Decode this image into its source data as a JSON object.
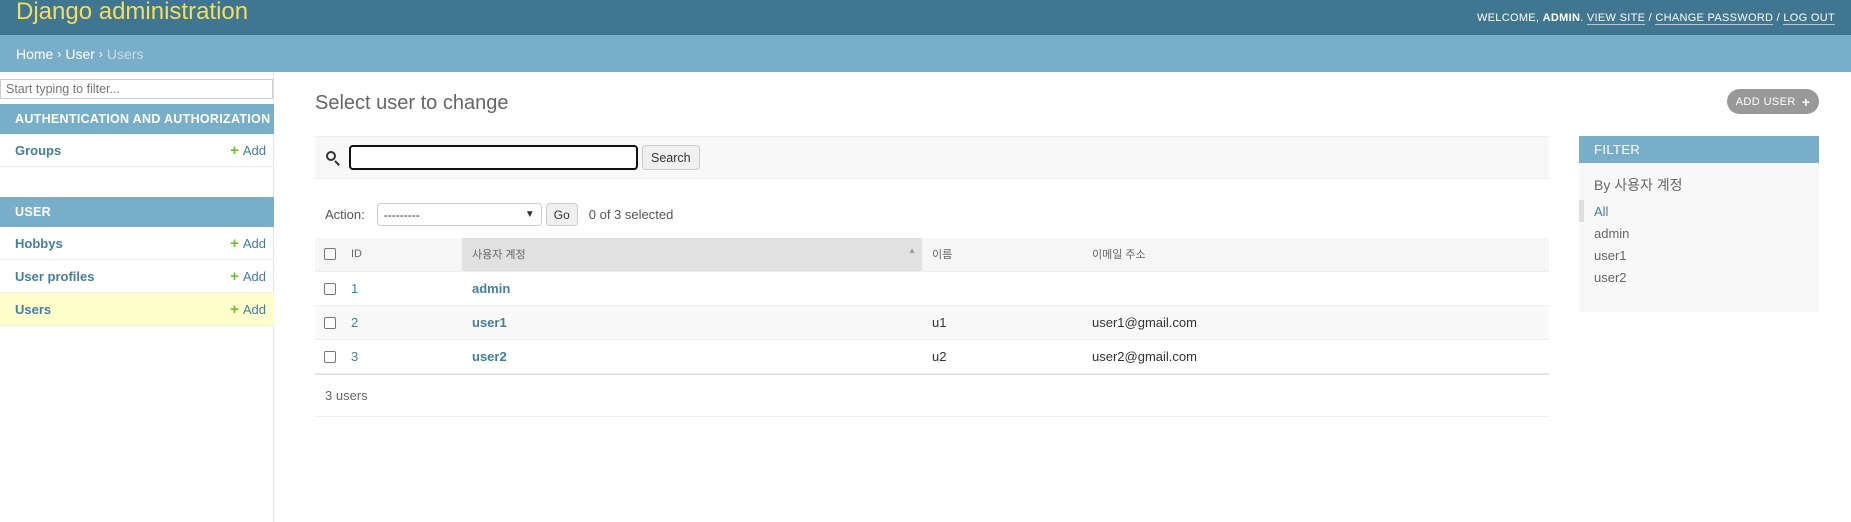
{
  "header": {
    "branding": "Django administration",
    "welcome": "Welcome,",
    "username": "admin",
    "links": [
      "View site",
      "Change password",
      "Log out"
    ]
  },
  "breadcrumbs": [
    "Home",
    "User",
    "Users"
  ],
  "sidebar": {
    "filter_placeholder": "Start typing to filter...",
    "modules": [
      {
        "caption": "Authentication and Authorization",
        "models": [
          {
            "name": "Groups",
            "add": "Add"
          }
        ]
      },
      {
        "caption": "User",
        "models": [
          {
            "name": "Hobbys",
            "add": "Add"
          },
          {
            "name": "User profiles",
            "add": "Add"
          },
          {
            "name": "Users",
            "add": "Add"
          }
        ]
      }
    ]
  },
  "content": {
    "title": "Select user to change",
    "add_button": "Add user",
    "search": {
      "value": "",
      "button": "Search"
    },
    "actions": {
      "label": "Action:",
      "selected": "---------",
      "go": "Go",
      "counter": "0 of 3 selected"
    },
    "table": {
      "headers": [
        "ID",
        "사용자 계정",
        "이름",
        "이메일 주소"
      ],
      "rows": [
        {
          "id": "1",
          "username": "admin",
          "name": "",
          "email": ""
        },
        {
          "id": "2",
          "username": "user1",
          "name": "u1",
          "email": "user1@gmail.com"
        },
        {
          "id": "3",
          "username": "user2",
          "name": "u2",
          "email": "user2@gmail.com"
        }
      ]
    },
    "paginator": "3 users"
  },
  "filter": {
    "caption": "Filter",
    "subtitle": "By 사용자 계정",
    "choices": [
      "All",
      "admin",
      "user1",
      "user2"
    ]
  },
  "colors": {
    "header": "#417690",
    "breadcrumbs": "#79aec8",
    "branding": "#f5dd5d",
    "link": "#447e9b",
    "add_green": "#70bf2b",
    "current_row": "#ffffcc"
  }
}
